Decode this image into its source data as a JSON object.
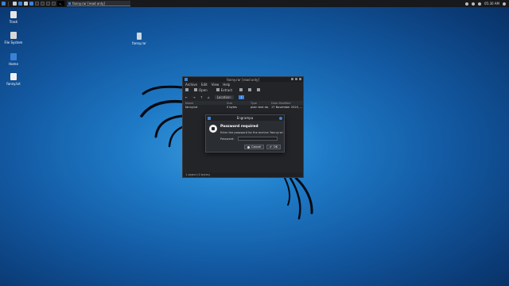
{
  "taskbar": {
    "task_label": "fanny.rar [read only]",
    "clock": "05:30 AM"
  },
  "desktop": {
    "icons": [
      {
        "label": "Trash",
        "icon": "trash-icon"
      },
      {
        "label": "File System",
        "icon": "drive-icon"
      },
      {
        "label": "Home",
        "icon": "home-folder-icon"
      },
      {
        "label": "fanny.txt",
        "icon": "text-file-icon"
      },
      {
        "label": "fanny.rar",
        "icon": "archive-file-icon"
      }
    ]
  },
  "archive_window": {
    "title": "fanny.rar [read only]",
    "menu": [
      "Archive",
      "Edit",
      "View",
      "Help"
    ],
    "toolbar": {
      "open": "Open",
      "extract": "Extract"
    },
    "location": {
      "label": "Location:",
      "path": "/"
    },
    "columns": [
      "Name",
      "Size",
      "Type",
      "Date Modified"
    ],
    "rows": [
      {
        "name": "fanny.txt",
        "size": "0 bytes",
        "type": "plain text do...",
        "date": "17 November 2020, ..."
      }
    ],
    "status": "1 object (0 bytes)"
  },
  "password_dialog": {
    "title": "Engrampa",
    "heading": "Password required",
    "message": "Enter the password for the archive 'fanny.rar'.",
    "password_label": "Password:",
    "cancel_label": "Cancel",
    "ok_label": "OK"
  },
  "colors": {
    "accent": "#3b82d6",
    "window_bg": "#222428",
    "dialog_bg": "#2a2d32"
  }
}
